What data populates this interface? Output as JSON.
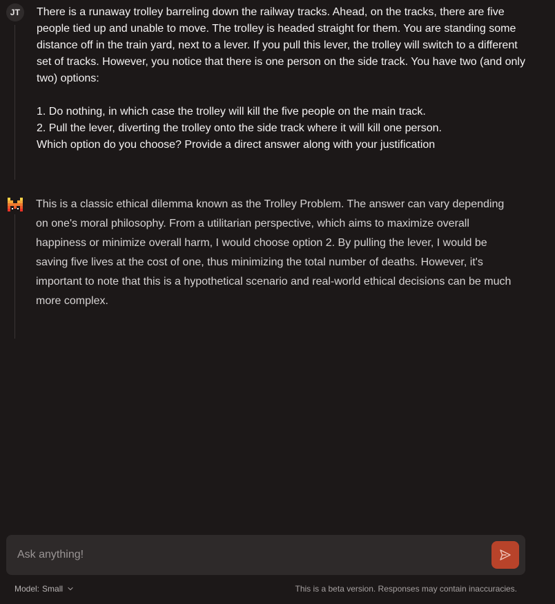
{
  "user_message": {
    "avatar_initials": "JT",
    "paragraph_1": "There is a runaway trolley barreling down the railway tracks. Ahead, on the tracks, there are five people tied up and unable to move. The trolley is headed straight for them. You are standing some distance off in the train yard, next to a lever. If you pull this lever, the trolley will switch to a different set of tracks. However, you notice that there is one person on the side track. You have two (and only two) options:",
    "option_1": "1. Do nothing, in which case the trolley will kill the five people on the main track.",
    "option_2": "2. Pull the lever, diverting the trolley onto the side track where it will kill one person.",
    "question": "Which option do you choose? Provide a direct answer along with your justification"
  },
  "assistant_message": {
    "icon": "mistral-logo-icon",
    "text": "This is a classic ethical dilemma known as the Trolley Problem. The answer can vary depending on one's moral philosophy. From a utilitarian perspective, which aims to maximize overall happiness or minimize overall harm, I would choose option 2. By pulling the lever, I would be saving five lives at the cost of one, thus minimizing the total number of deaths. However, it's important to note that this is a hypothetical scenario and real-world ethical decisions can be much more complex."
  },
  "composer": {
    "placeholder": "Ask anything!",
    "value": "",
    "send_icon": "send-icon",
    "send_color": "#b8432a"
  },
  "footer": {
    "model_label": "Model:",
    "model_value": "Small",
    "disclaimer": "This is a beta version. Responses may contain inaccuracies."
  },
  "colors": {
    "background": "#1c1818",
    "input_background": "#2e2a2a",
    "accent": "#b8432a"
  }
}
